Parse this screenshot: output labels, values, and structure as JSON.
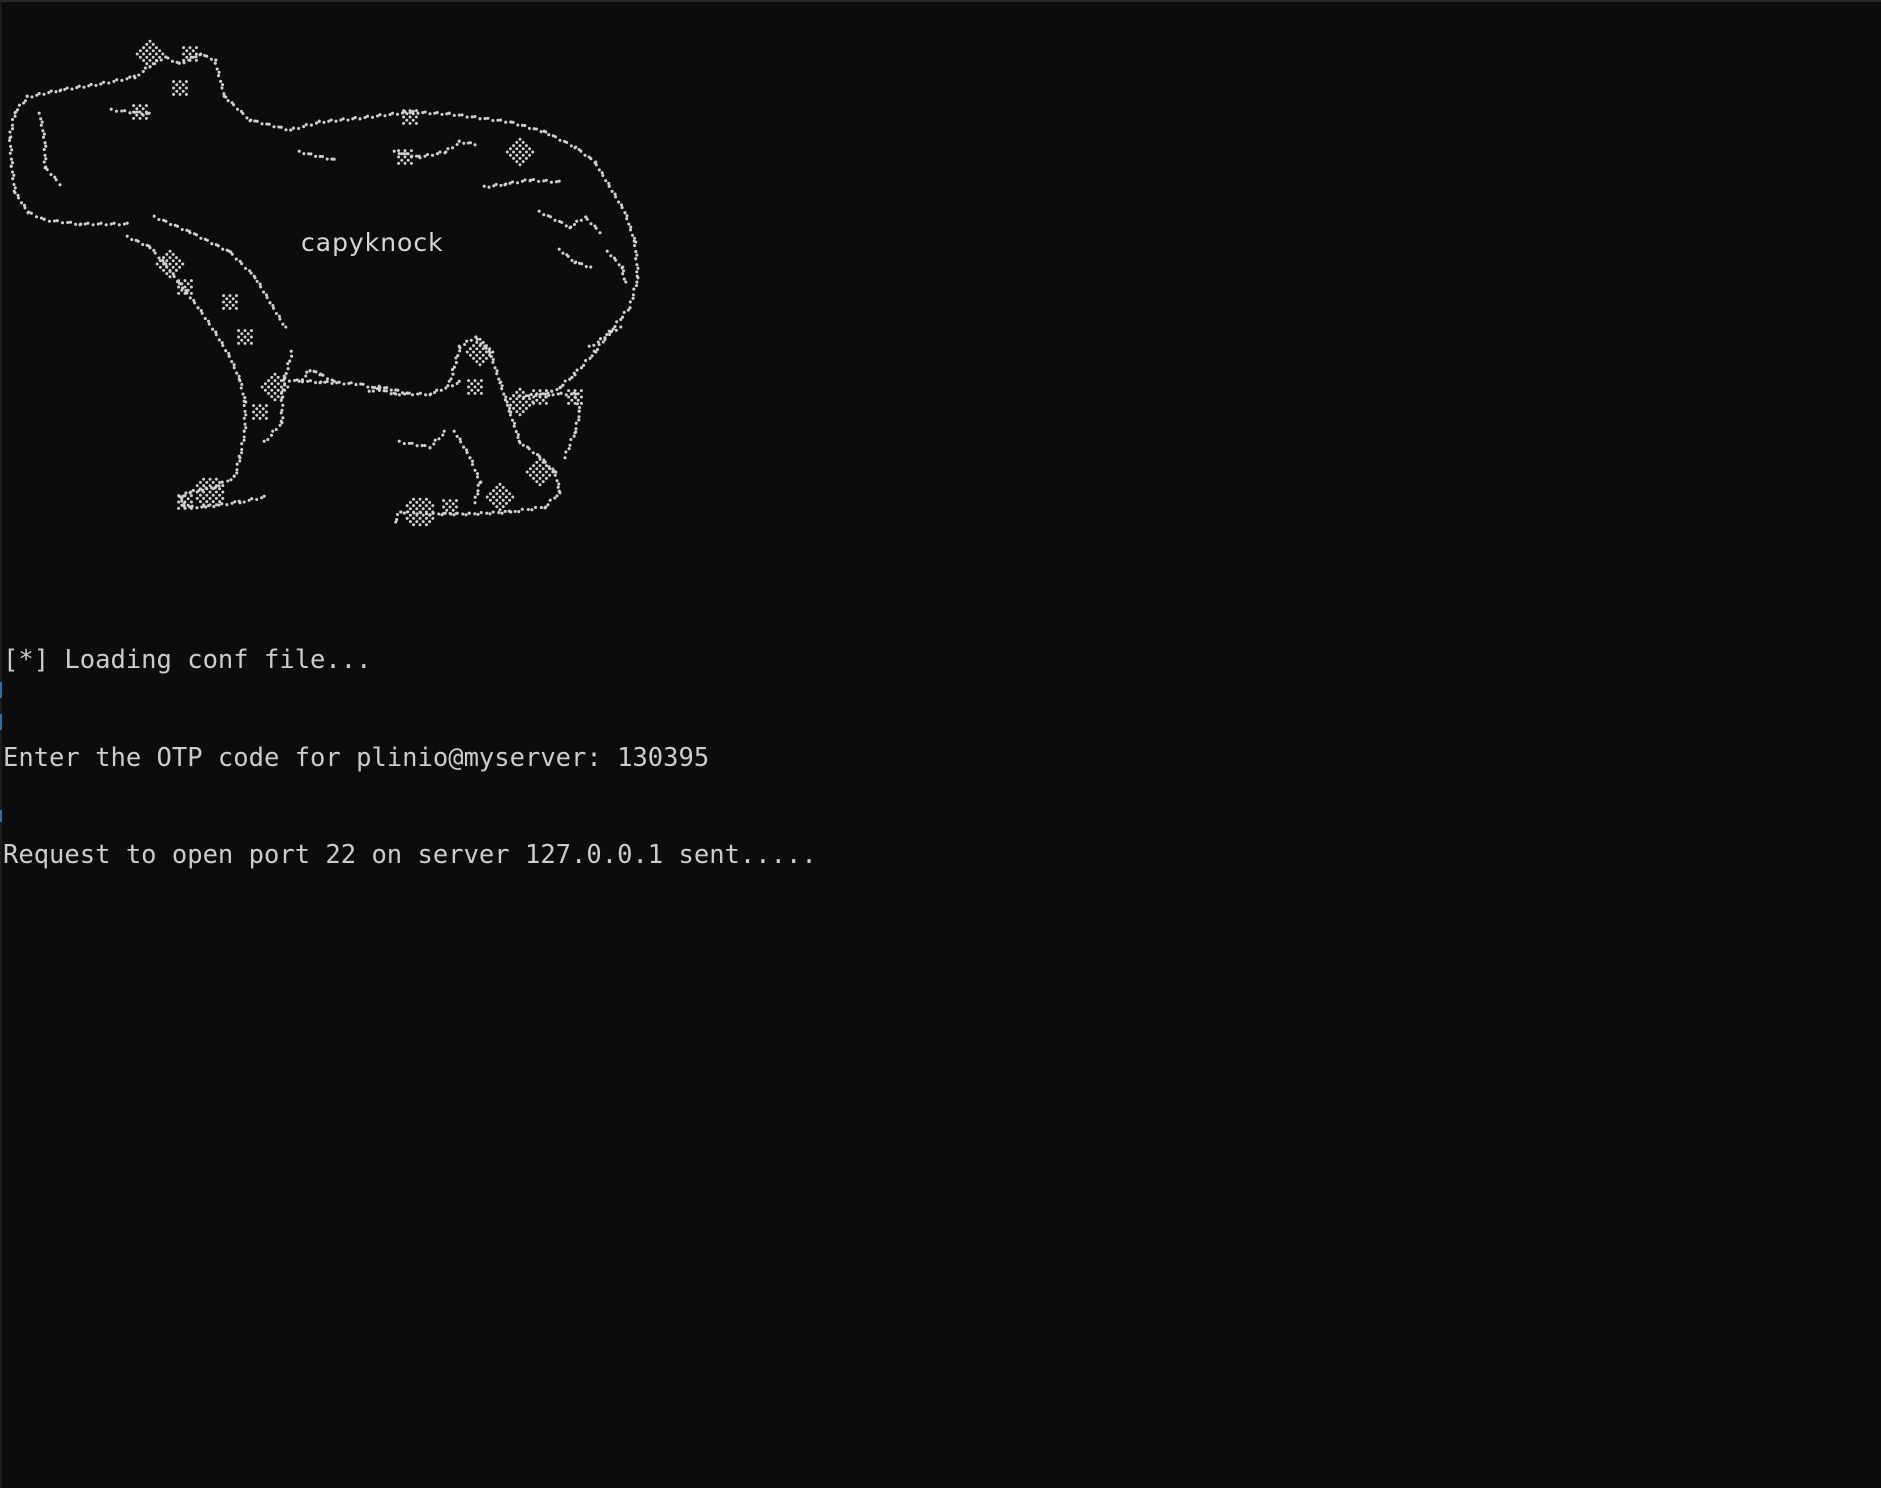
{
  "window": {
    "background_color": "#0c0c0c",
    "foreground_color": "#cccccc"
  },
  "banner": {
    "title": "capyknock",
    "art_icon": "capybara-ascii-art"
  },
  "output": {
    "lines": [
      "[*] Loading conf file...",
      "Enter the OTP code for plinio@myserver: 130395",
      "Request to open port 22 on server 127.0.0.1 sent....."
    ]
  }
}
